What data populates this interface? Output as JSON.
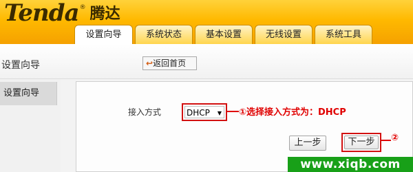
{
  "brand": {
    "en": "Tenda",
    "cn": "腾达",
    "reg": "®"
  },
  "tabs": [
    {
      "label": "设置向导",
      "active": true
    },
    {
      "label": "系统状态",
      "active": false
    },
    {
      "label": "基本设置",
      "active": false
    },
    {
      "label": "无线设置",
      "active": false
    },
    {
      "label": "系统工具",
      "active": false
    }
  ],
  "subheader": {
    "title": "设置向导",
    "home_button": "返回首页"
  },
  "sidebar": {
    "items": [
      {
        "label": "设置向导"
      }
    ]
  },
  "form": {
    "access_label": "接入方式",
    "access_value": "DHCP"
  },
  "annotations": {
    "step1": "①选择接入方式为：DHCP",
    "step2": "②"
  },
  "buttons": {
    "prev": "上一步",
    "next": "下一步"
  },
  "watermark": "www.xiqb.com",
  "colors": {
    "header": "#ffb900",
    "annotation": "#e00000",
    "watermark_bg": "#18a018"
  }
}
